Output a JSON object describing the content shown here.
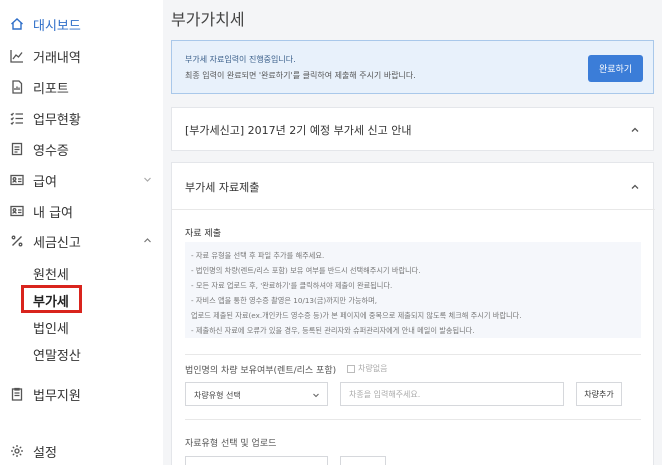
{
  "sidebar": {
    "items": [
      {
        "label": "대시보드",
        "icon": "home-icon"
      },
      {
        "label": "거래내역",
        "icon": "trend-chart-icon"
      },
      {
        "label": "리포트",
        "icon": "report-icon"
      },
      {
        "label": "업무현황",
        "icon": "task-list-icon"
      },
      {
        "label": "영수증",
        "icon": "receipt-icon"
      },
      {
        "label": "급여",
        "icon": "id-card-icon"
      },
      {
        "label": "내 급여",
        "icon": "id-card-icon"
      },
      {
        "label": "세금신고",
        "icon": "percent-icon"
      }
    ],
    "tax_subitems": [
      "원천세",
      "부가세",
      "법인세",
      "연말정산"
    ],
    "bottom_items": [
      {
        "label": "법무지원",
        "icon": "clipboard-icon"
      },
      {
        "label": "설정",
        "icon": "gear-icon"
      }
    ],
    "active_color": "#2f6fc9",
    "highlight_color": "#d9241d"
  },
  "main": {
    "title": "부가가치세",
    "notice": {
      "line1": "부가세 자료입력이 진행중입니다.",
      "line2": "최종 입력이 완료되면 '완료하기'를 클릭하여 제출해 주시기 바랍니다.",
      "button": "완료하기"
    },
    "announcement": {
      "title": "[부가세신고] 2017년 2기 예정 부가세 신고 안내"
    },
    "submission": {
      "title": "부가세 자료제출",
      "section_label": "자료 제출",
      "info_lines": [
        "- 자료 유형을 선택 후 파일 추가를 해주세요.",
        "- 법인명의 차량(렌트/리스 포함) 보유 여부를 반드시 선택해주시기 바랍니다.",
        "- 모든 자료 업로드 후, '완료하기'를 클릭하셔야 제출이 완료됩니다.",
        "- 자비스 앱을 통한 영수증 촬영은 10/13(금)까지만 가능하며,",
        "업로드 제출된 자료(ex.개인카드 영수증 등)가 본 페이지에 중복으로 제출되지 않도록 체크해 주시기 바랍니다.",
        "- 제출하신 자료에 오류가 있을 경우, 등록된 관리자와 슈퍼관리자에게 안내 메일이 발송됩니다."
      ],
      "vehicle_label": "법인명의 차량 보유여부(렌트/리스 포함)",
      "no_vehicle_label": "차량없음",
      "vehicle_type_select": "차량유형 선택",
      "vehicle_input_placeholder": "차종을 입력해주세요.",
      "add_vehicle_button": "차량추가",
      "upload_label": "자료유형 선택 및 업로드"
    },
    "primary_color": "#3b7dd8",
    "notice_bg": "#e8f1fb"
  }
}
